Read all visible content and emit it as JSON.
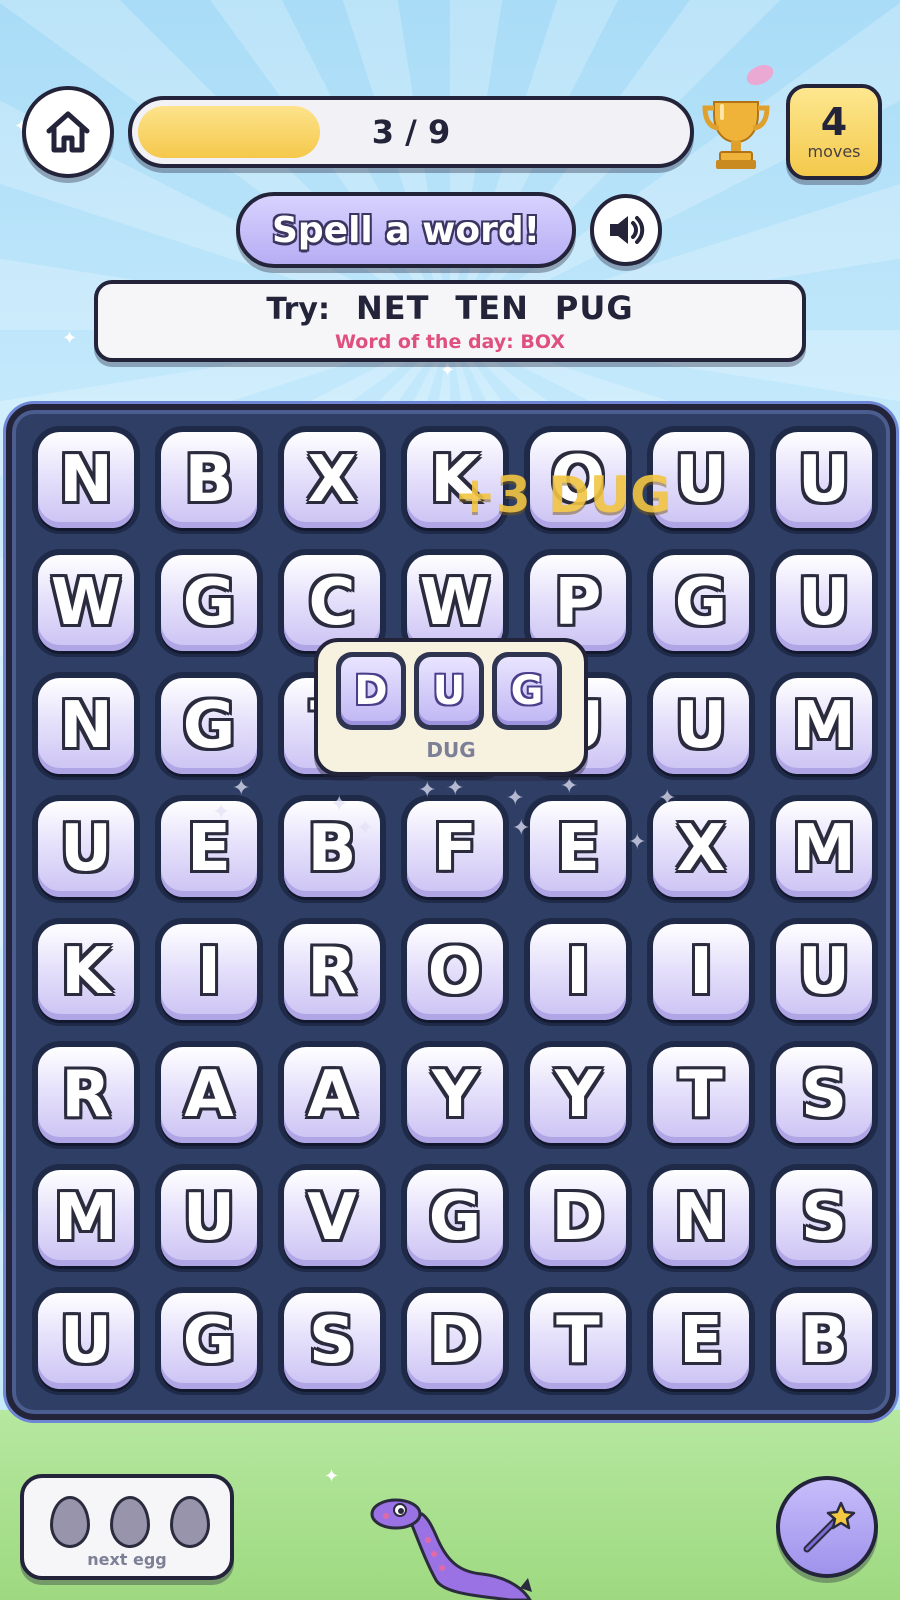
{
  "header": {
    "home_icon": "home-icon",
    "progress_text": "3 / 9",
    "progress_fraction": 0.333,
    "trophy_icon": "trophy-icon",
    "moves_count": "4",
    "moves_label": "moves"
  },
  "prompt": {
    "title": "Spell a word!",
    "sound_icon": "speaker-icon"
  },
  "hint": {
    "prefix": "Try:",
    "words": [
      "NET",
      "TEN",
      "PUG"
    ],
    "word_of_day": "Word of the day: BOX"
  },
  "board": {
    "rows": [
      [
        "N",
        "B",
        "X",
        "K",
        "O",
        "U",
        "U"
      ],
      [
        "W",
        "G",
        "C",
        "W",
        "P",
        "G",
        "U"
      ],
      [
        "N",
        "G",
        "T",
        "D",
        "U",
        "U",
        "M"
      ],
      [
        "U",
        "E",
        "B",
        "F",
        "E",
        "X",
        "M"
      ],
      [
        "K",
        "I",
        "R",
        "O",
        "I",
        "I",
        "U"
      ],
      [
        "R",
        "A",
        "A",
        "Y",
        "Y",
        "T",
        "S"
      ],
      [
        "M",
        "U",
        "V",
        "G",
        "D",
        "N",
        "S"
      ],
      [
        "U",
        "G",
        "S",
        "D",
        "T",
        "E",
        "B"
      ]
    ]
  },
  "feedback": {
    "float_text": "+3 DUG",
    "found_letters": [
      "D",
      "U",
      "G"
    ],
    "found_word": "DUG"
  },
  "footer": {
    "egg_count": 3,
    "egg_label": "next egg",
    "wand_icon": "magic-wand-icon",
    "mascot_icon": "dinosaur-icon"
  },
  "colors": {
    "board": "#2f3e64",
    "tile": "#dcd6fa",
    "progress": "#f5c84b",
    "accent_pink": "#e0507e",
    "outline": "#23233a"
  }
}
